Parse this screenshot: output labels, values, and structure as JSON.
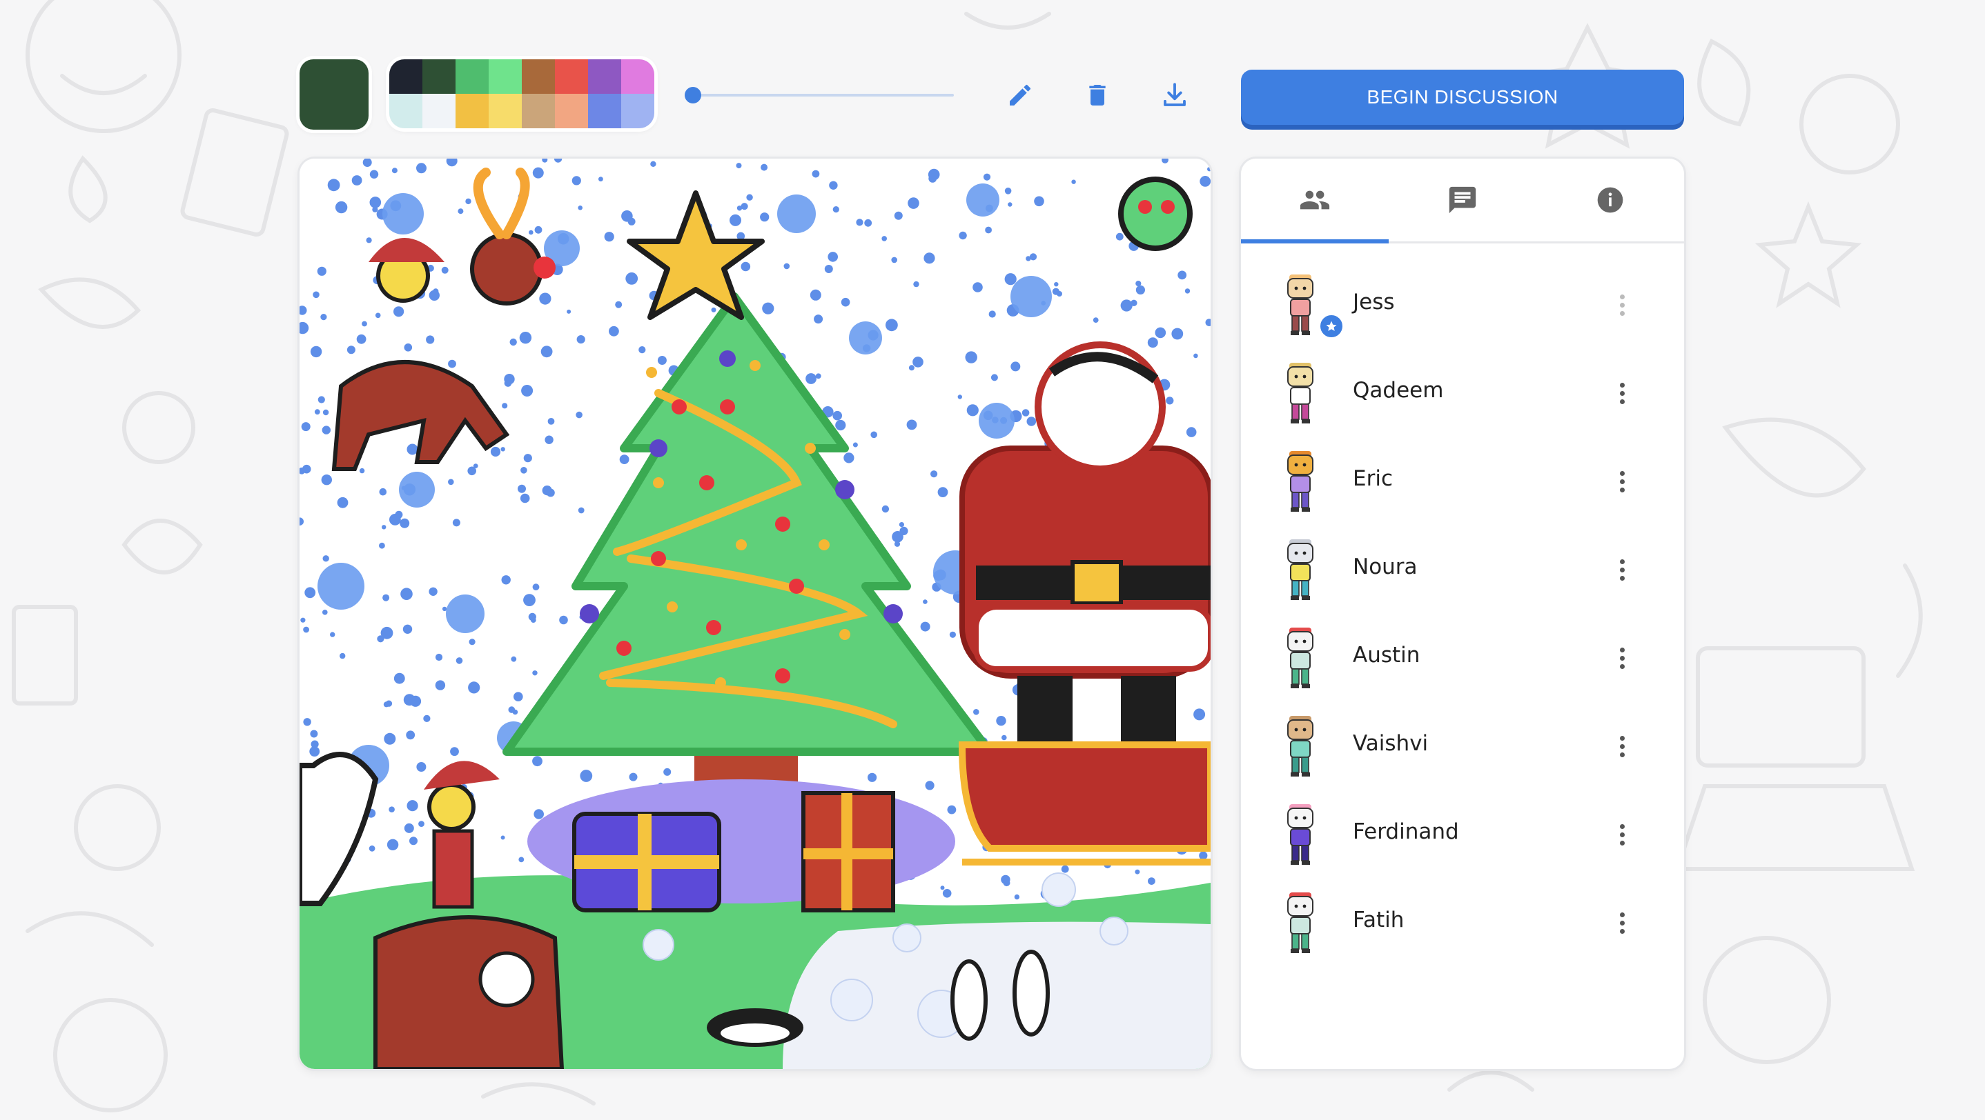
{
  "toolbar": {
    "current_color": "#2e5034",
    "palette": [
      "#1f2430",
      "#2e5034",
      "#4fbd6e",
      "#6fe38c",
      "#a8693a",
      "#e8534a",
      "#8e58c2",
      "#e07be0",
      "#d2ecec",
      "#f1f4f8",
      "#f2c043",
      "#f7dc6a",
      "#cba57a",
      "#f2a682",
      "#6d87e6",
      "#9fb3f2"
    ],
    "brush_size_fraction": 0.02,
    "icons": [
      "pencil-icon",
      "trash-icon",
      "download-icon"
    ],
    "begin_label": "BEGIN DISCUSSION"
  },
  "tabs": [
    "people-icon",
    "chat-icon",
    "info-icon"
  ],
  "players": [
    {
      "name": "Jess",
      "host": true,
      "hair": "#f5c27a",
      "shirt": "#f0a0a0",
      "pants": "#9a4b4b",
      "head": "#f2d6a8"
    },
    {
      "name": "Qadeem",
      "host": false,
      "hair": "#e2c26a",
      "shirt": "#ffffff",
      "pants": "#c5499a",
      "head": "#f2e0a8"
    },
    {
      "name": "Eric",
      "host": false,
      "hair": "#e68a2e",
      "shirt": "#b38fe8",
      "pants": "#6c56c8",
      "head": "#f0b040"
    },
    {
      "name": "Noura",
      "host": false,
      "hair": "#c8ccd6",
      "shirt": "#f2e25a",
      "pants": "#45b3c4",
      "head": "#e6e8ee"
    },
    {
      "name": "Austin",
      "host": false,
      "hair": "#e44b4b",
      "shirt": "#cde8e0",
      "pants": "#4bb48a",
      "head": "#f4f4f4"
    },
    {
      "name": "Vaishvi",
      "host": false,
      "hair": "#c89a6a",
      "shirt": "#7fd6c4",
      "pants": "#3a9c8c",
      "head": "#e0b88a"
    },
    {
      "name": "Ferdinand",
      "host": false,
      "hair": "#f4a0c0",
      "shirt": "#6a4bd6",
      "pants": "#3a2a8a",
      "head": "#f6f6f6"
    },
    {
      "name": "Fatih",
      "host": false,
      "hair": "#e44b4b",
      "shirt": "#cde8e0",
      "pants": "#4bb48a",
      "head": "#f4f4f4"
    }
  ]
}
